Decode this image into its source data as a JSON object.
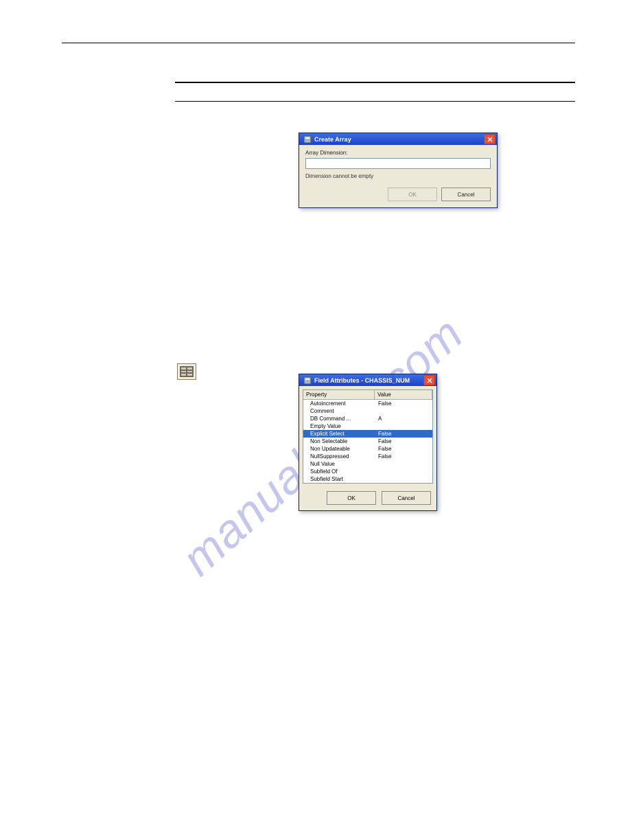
{
  "watermark_text": "manualslive.com",
  "dialog1": {
    "title": "Create Array",
    "label": "Array Dimension:",
    "input_value": "",
    "hint": "Dimension cannot be empty",
    "ok": "OK",
    "cancel": "Cancel"
  },
  "dialog2": {
    "title": "Field Attributes - CHASSIS_NUM",
    "header_property": "Property",
    "header_value": "Value",
    "rows": [
      {
        "prop": "Autoincrement",
        "val": "False"
      },
      {
        "prop": "Comment",
        "val": ""
      },
      {
        "prop": "DB Command ...",
        "val": "A"
      },
      {
        "prop": "Empty Value",
        "val": ""
      },
      {
        "prop": "Explicit Select",
        "val": "False"
      },
      {
        "prop": "Non Selectable",
        "val": "False"
      },
      {
        "prop": "Non Updateable",
        "val": "False"
      },
      {
        "prop": "NullSuppressed",
        "val": "False"
      },
      {
        "prop": "Null Value",
        "val": ""
      },
      {
        "prop": "Subfield Of",
        "val": ""
      },
      {
        "prop": "Subfield Start",
        "val": ""
      }
    ],
    "selected_index": 4,
    "ok": "OK",
    "cancel": "Cancel"
  }
}
